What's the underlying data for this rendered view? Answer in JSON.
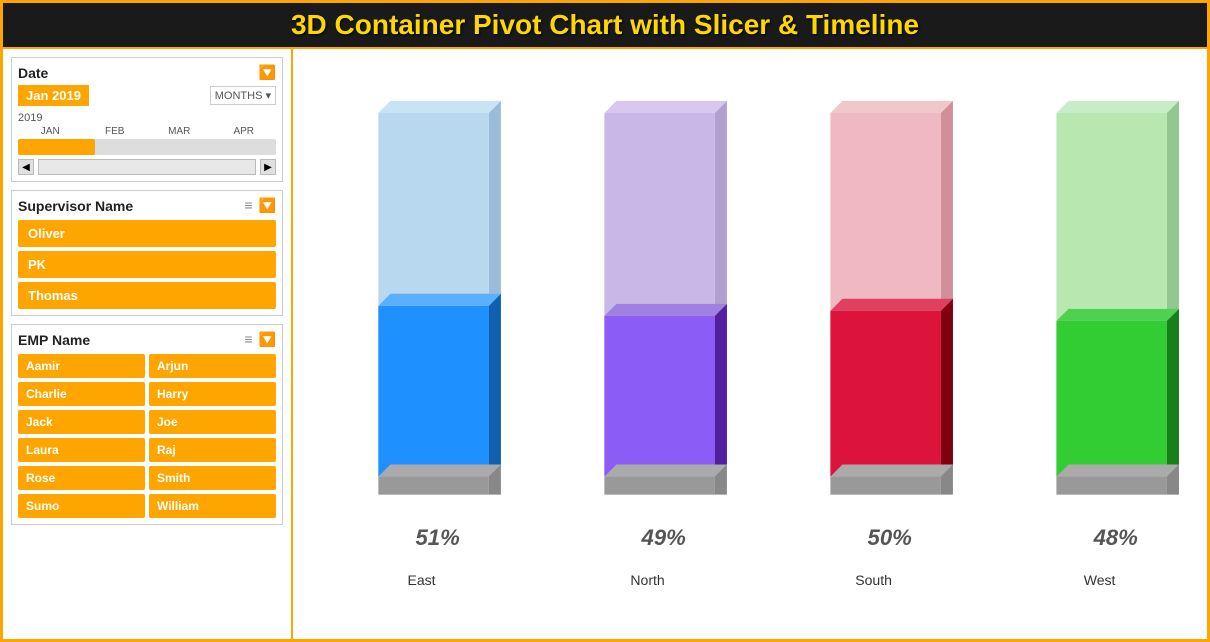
{
  "title": "3D Container Pivot Chart with Slicer & Timeline",
  "date_slicer": {
    "title": "Date",
    "selected": "Jan 2019",
    "dropdown": "MONTHS ▾",
    "year": "2019",
    "months": [
      "JAN",
      "FEB",
      "MAR",
      "APR"
    ]
  },
  "supervisor_slicer": {
    "title": "Supervisor Name",
    "items": [
      "Oliver",
      "PK",
      "Thomas"
    ]
  },
  "emp_slicer": {
    "title": "EMP Name",
    "items": [
      "Aamir",
      "Arjun",
      "Charlie",
      "Harry",
      "Jack",
      "Joe",
      "Laura",
      "Raj",
      "Rose",
      "Smith",
      "Sumo",
      "William"
    ]
  },
  "chart": {
    "bars": [
      {
        "region": "East",
        "pct": "51%",
        "ghost_height": 340,
        "actual_height": 175,
        "color_front": "#1E90FF",
        "color_ghost": "#b0d8f0",
        "color_right": "#1060b0",
        "color_ghost_right": "#8ab8d8",
        "color_top": "#5ab0ff",
        "color_ghost_top": "#d0e8f8"
      },
      {
        "region": "North",
        "pct": "49%",
        "ghost_height": 340,
        "actual_height": 160,
        "color_front": "#8B5CF6",
        "color_ghost": "#c8b8e8",
        "color_right": "#6030b0",
        "color_ghost_right": "#a890c8",
        "color_top": "#a080e0",
        "color_ghost_top": "#ddd0f0"
      },
      {
        "region": "South",
        "pct": "50%",
        "ghost_height": 340,
        "actual_height": 165,
        "color_front": "#DC143C",
        "color_ghost": "#f0b8c0",
        "color_right": "#900020",
        "color_ghost_right": "#d090a0",
        "color_top": "#e04060",
        "color_ghost_top": "#f8d0d8"
      },
      {
        "region": "West",
        "pct": "48%",
        "ghost_height": 340,
        "actual_height": 155,
        "color_front": "#32CD32",
        "color_ghost": "#b8e8b0",
        "color_right": "#208020",
        "color_ghost_right": "#90c890",
        "color_top": "#50d050",
        "color_ghost_top": "#d0f0d0"
      }
    ]
  }
}
